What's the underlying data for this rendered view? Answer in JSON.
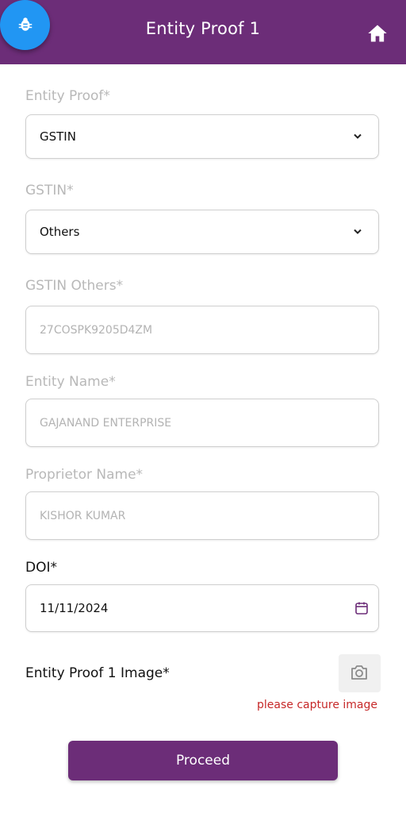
{
  "header": {
    "title": "Entity Proof 1",
    "background_color": "#6c2d78",
    "home_icon": "home-icon",
    "debug_icon": "bug-icon",
    "debug_button_color": "#2196f3"
  },
  "form": {
    "entity_proof": {
      "label": "Entity Proof*",
      "value": "GSTIN"
    },
    "gstin": {
      "label": "GSTIN*",
      "value": "Others"
    },
    "gstin_others": {
      "label": "GSTIN Others*",
      "value": "27COSPK9205D4ZM"
    },
    "entity_name": {
      "label": "Entity Name*",
      "value": "GAJANAND ENTERPRISE"
    },
    "proprietor_name": {
      "label": "Proprietor Name*",
      "value": "KISHOR KUMAR"
    },
    "doi": {
      "label": "DOI*",
      "value": "11/11/2024"
    },
    "image": {
      "label": "Entity Proof 1 Image*",
      "error": "please capture image",
      "error_color": "#c62828"
    }
  },
  "actions": {
    "proceed_label": "Proceed"
  }
}
